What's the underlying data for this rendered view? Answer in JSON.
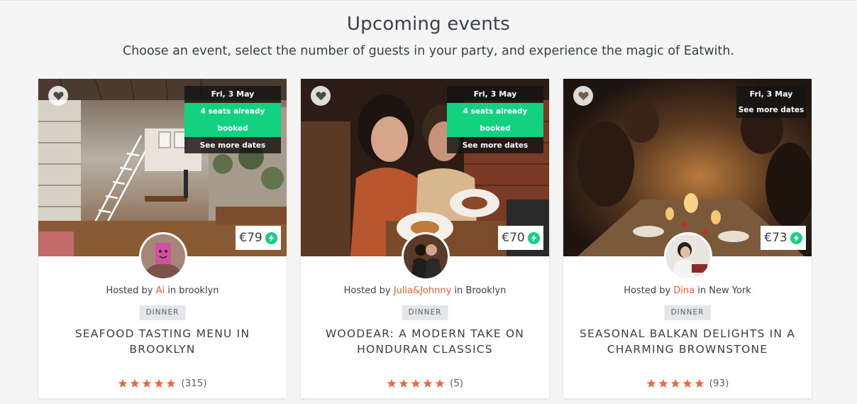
{
  "header": {
    "title": "Upcoming events",
    "subtitle": "Choose an event, select the number of guests in your party, and experience the magic of Eatwith."
  },
  "colors": {
    "accent": "#f05f2d",
    "green": "#12d180",
    "star": "#f0643c"
  },
  "events": [
    {
      "date": "Fri, 3 May",
      "seats": "4 seats already booked",
      "more_dates": "See more dates",
      "price": "€79",
      "host_prefix": "Hosted by",
      "host_name": "Ai",
      "host_location": "in brooklyn",
      "tag": "DINNER",
      "title": "SEAFOOD TASTING MENU IN BROOKLYN",
      "rating": 5,
      "reviews": "(315)"
    },
    {
      "date": "Fri, 3 May",
      "seats": "4 seats already booked",
      "more_dates": "See more dates",
      "price": "€70",
      "host_prefix": "Hosted by",
      "host_name": "Julia&Johnny",
      "host_location": "in Brooklyn",
      "tag": "DINNER",
      "title": "WOODEAR: A MODERN TAKE ON HONDURAN CLASSICS",
      "rating": 5,
      "reviews": "(5)"
    },
    {
      "date": "Fri, 3 May",
      "more_dates": "See more dates",
      "price": "€73",
      "host_prefix": "Hosted by",
      "host_name": "Dina",
      "host_location": "in New York",
      "tag": "DINNER",
      "title": "SEASONAL BALKAN DELIGHTS IN A CHARMING BROWNSTONE",
      "rating": 5,
      "reviews": "(93)"
    }
  ]
}
